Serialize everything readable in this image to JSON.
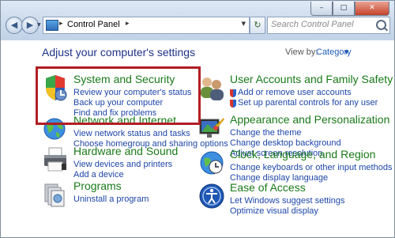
{
  "window": {
    "controls": {
      "minimize": "–",
      "maximize": "□",
      "close": "✕"
    }
  },
  "nav": {
    "back": "◀",
    "forward": "▶",
    "dropdown": "▼",
    "refresh": "↻"
  },
  "address": {
    "icon": "control-panel-icon",
    "separator": "▸",
    "path": "Control Panel",
    "trailing_separator": "▸",
    "dropdown": "▼"
  },
  "search": {
    "placeholder": "Search Control Panel"
  },
  "main": {
    "heading": "Adjust your computer's settings",
    "view_by_label": "View by:",
    "view_by_value": "Category",
    "view_by_arrow": "▼"
  },
  "categories": [
    {
      "icon": "security-shield-icon",
      "title": "System and Security",
      "links": [
        "Review your computer's status",
        "Back up your computer",
        "Find and fix problems"
      ]
    },
    {
      "icon": "network-globe-icon",
      "title": "Network and Internet",
      "links": [
        "View network status and tasks",
        "Choose homegroup and sharing options"
      ]
    },
    {
      "icon": "printer-icon",
      "title": "Hardware and Sound",
      "links": [
        "View devices and printers",
        "Add a device"
      ]
    },
    {
      "icon": "programs-icon",
      "title": "Programs",
      "links": [
        "Uninstall a program"
      ]
    },
    {
      "icon": "users-icon",
      "title": "User Accounts and Family Safety",
      "links": [
        "Add or remove user accounts",
        "Set up parental controls for any user"
      ]
    },
    {
      "icon": "personalization-icon",
      "title": "Appearance and Personalization",
      "links": [
        "Change the theme",
        "Change desktop background",
        "Adjust screen resolution"
      ]
    },
    {
      "icon": "clock-globe-icon",
      "title": "Clock, Language, and Region",
      "links": [
        "Change keyboards or other input methods",
        "Change display language"
      ]
    },
    {
      "icon": "ease-of-access-icon",
      "title": "Ease of Access",
      "links": [
        "Let Windows suggest settings",
        "Optimize visual display"
      ]
    }
  ],
  "colors": {
    "category_title": "#1a7a1a",
    "link": "#1e46a8",
    "heading": "#1e3287",
    "highlight_border": "#b01e24"
  }
}
